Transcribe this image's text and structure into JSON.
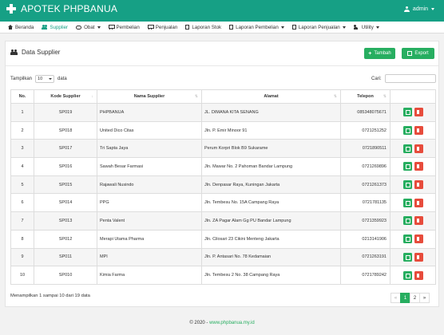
{
  "app": {
    "title": "APOTEK PHPBANUA",
    "user": "admin"
  },
  "nav": [
    {
      "label": "Beranda",
      "icon": "home-icon",
      "active": false,
      "dropdown": false
    },
    {
      "label": "Supplier",
      "icon": "users-icon",
      "active": true,
      "dropdown": false
    },
    {
      "label": "Obat",
      "icon": "pill-icon",
      "active": false,
      "dropdown": true
    },
    {
      "label": "Pembelian",
      "icon": "cart-icon",
      "active": false,
      "dropdown": false
    },
    {
      "label": "Penjualan",
      "icon": "cart-icon",
      "active": false,
      "dropdown": false
    },
    {
      "label": "Laporan Stok",
      "icon": "file-icon",
      "active": false,
      "dropdown": false
    },
    {
      "label": "Laporan Pembelian",
      "icon": "file-icon",
      "active": false,
      "dropdown": true
    },
    {
      "label": "Laporan Penjualan",
      "icon": "file-icon",
      "active": false,
      "dropdown": true
    },
    {
      "label": "Utility",
      "icon": "user-plus-icon",
      "active": false,
      "dropdown": true
    }
  ],
  "panel": {
    "title": "Data Supplier",
    "add_label": "Tambah",
    "export_label": "Export"
  },
  "table_ctrl": {
    "show_prefix": "Tampilkan",
    "show_value": "10",
    "show_suffix": "data",
    "search_label": "Cari:"
  },
  "columns": [
    "No.",
    "Kode Supplier",
    "Nama Supplier",
    "Alamat",
    "Telepon",
    ""
  ],
  "rows": [
    {
      "no": "1",
      "kode": "SP019",
      "nama": "PHPBANUA",
      "alamat": "JL. DIMANA KITA SENANG",
      "telepon": "085348075671"
    },
    {
      "no": "2",
      "kode": "SP018",
      "nama": "United Dico Citas",
      "alamat": "Jln. P. Emir Minoor 91",
      "telepon": "0721251252"
    },
    {
      "no": "3",
      "kode": "SP017",
      "nama": "Tri Sapta Jaya",
      "alamat": "Perum Korpri Blok B9 Sukarame",
      "telepon": "0721890511"
    },
    {
      "no": "4",
      "kode": "SP016",
      "nama": "Sawah Besar Farmasi",
      "alamat": "Jln. Mawar No. 2 Pahoman Bandar Lampung",
      "telepon": "0721269896"
    },
    {
      "no": "5",
      "kode": "SP015",
      "nama": "Rajawali Nusindo",
      "alamat": "Jln. Denpasar Raya, Kuningan Jakarta",
      "telepon": "0721261373"
    },
    {
      "no": "6",
      "kode": "SP014",
      "nama": "PPG",
      "alamat": "Jln. Tembesu No. 15A Campang Raya",
      "telepon": "0721781135"
    },
    {
      "no": "7",
      "kode": "SP013",
      "nama": "Penta Valent",
      "alamat": "Jln. ZA Pagar Alam Gg PU Bandar Lampung",
      "telepon": "0721359923"
    },
    {
      "no": "8",
      "kode": "SP012",
      "nama": "Merapi Utama Pharma",
      "alamat": "Jln. Cilosari 23 Cikini Menteng Jakarta",
      "telepon": "0213141906"
    },
    {
      "no": "9",
      "kode": "SP011",
      "nama": "MPI",
      "alamat": "Jln. P. Antasari No. 78 Kedamaian",
      "telepon": "0721263191"
    },
    {
      "no": "10",
      "kode": "SP010",
      "nama": "Kimia Farma",
      "alamat": "Jln. Tembesu 2 No. 38 Campang Raya",
      "telepon": "0721789242"
    }
  ],
  "info": "Menampilkan 1 sampai 10 dari 19 data",
  "pager": {
    "prev": "«",
    "pages": [
      "1",
      "2"
    ],
    "next": "»",
    "current": "1"
  },
  "footer": {
    "prefix": "© 2020 - ",
    "link": "www.phpbanua.my.id"
  },
  "colors": {
    "brand": "#16a085",
    "primary": "#27ae60",
    "danger": "#e74c3c"
  }
}
